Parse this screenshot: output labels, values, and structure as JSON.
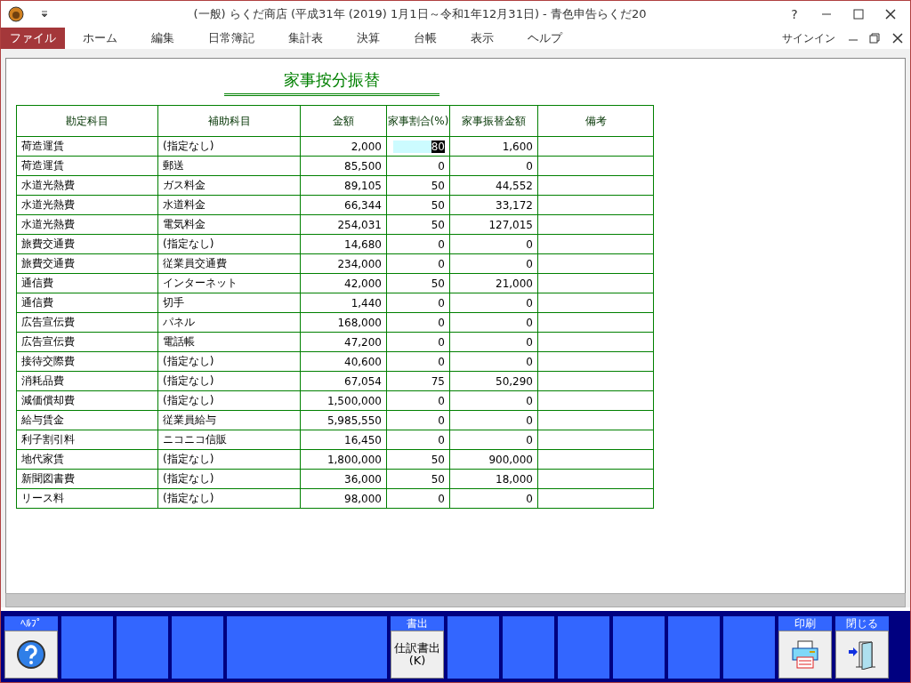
{
  "window": {
    "title": "(一般) らくだ商店 (平成31年 (2019) 1月1日～令和1年12月31日) - 青色申告らくだ20",
    "help": "?",
    "signin": "サインイン"
  },
  "menu": [
    {
      "label": "ファイル",
      "selected": true
    },
    {
      "label": "ホーム",
      "selected": false
    },
    {
      "label": "編集",
      "selected": false
    },
    {
      "label": "日常簿記",
      "selected": false
    },
    {
      "label": "集計表",
      "selected": false
    },
    {
      "label": "決算",
      "selected": false
    },
    {
      "label": "台帳",
      "selected": false
    },
    {
      "label": "表示",
      "selected": false
    },
    {
      "label": "ヘルプ",
      "selected": false
    }
  ],
  "page_title": "家事按分振替",
  "table": {
    "columns": [
      "勘定科目",
      "補助科目",
      "金額",
      "家事割合(%)",
      "家事振替金額",
      "備考"
    ],
    "rows": [
      {
        "account": "荷造運賃",
        "sub": "(指定なし)",
        "amount": "2,000",
        "rate": "80",
        "transfer": "1,600",
        "selected": true
      },
      {
        "account": "荷造運賃",
        "sub": "郵送",
        "amount": "85,500",
        "rate": "0",
        "transfer": "0",
        "selected": false
      },
      {
        "account": "水道光熱費",
        "sub": "ガス料金",
        "amount": "89,105",
        "rate": "50",
        "transfer": "44,552",
        "selected": false
      },
      {
        "account": "水道光熱費",
        "sub": "水道料金",
        "amount": "66,344",
        "rate": "50",
        "transfer": "33,172",
        "selected": false
      },
      {
        "account": "水道光熱費",
        "sub": "電気料金",
        "amount": "254,031",
        "rate": "50",
        "transfer": "127,015",
        "selected": false
      },
      {
        "account": "旅費交通費",
        "sub": "(指定なし)",
        "amount": "14,680",
        "rate": "0",
        "transfer": "0",
        "selected": false
      },
      {
        "account": "旅費交通費",
        "sub": "従業員交通費",
        "amount": "234,000",
        "rate": "0",
        "transfer": "0",
        "selected": false
      },
      {
        "account": "通信費",
        "sub": "インターネット",
        "amount": "42,000",
        "rate": "50",
        "transfer": "21,000",
        "selected": false
      },
      {
        "account": "通信費",
        "sub": "切手",
        "amount": "1,440",
        "rate": "0",
        "transfer": "0",
        "selected": false
      },
      {
        "account": "広告宣伝費",
        "sub": "パネル",
        "amount": "168,000",
        "rate": "0",
        "transfer": "0",
        "selected": false
      },
      {
        "account": "広告宣伝費",
        "sub": "電話帳",
        "amount": "47,200",
        "rate": "0",
        "transfer": "0",
        "selected": false
      },
      {
        "account": "接待交際費",
        "sub": "(指定なし)",
        "amount": "40,600",
        "rate": "0",
        "transfer": "0",
        "selected": false
      },
      {
        "account": "消耗品費",
        "sub": "(指定なし)",
        "amount": "67,054",
        "rate": "75",
        "transfer": "50,290",
        "selected": false
      },
      {
        "account": "減価償却費",
        "sub": "(指定なし)",
        "amount": "1,500,000",
        "rate": "0",
        "transfer": "0",
        "selected": false
      },
      {
        "account": "給与賃金",
        "sub": "従業員給与",
        "amount": "5,985,550",
        "rate": "0",
        "transfer": "0",
        "selected": false
      },
      {
        "account": "利子割引料",
        "sub": "ニコニコ信販",
        "amount": "16,450",
        "rate": "0",
        "transfer": "0",
        "selected": false
      },
      {
        "account": "地代家賃",
        "sub": "(指定なし)",
        "amount": "1,800,000",
        "rate": "50",
        "transfer": "900,000",
        "selected": false
      },
      {
        "account": "新聞図書費",
        "sub": "(指定なし)",
        "amount": "36,000",
        "rate": "50",
        "transfer": "18,000",
        "selected": false
      },
      {
        "account": "リース料",
        "sub": "(指定なし)",
        "amount": "98,000",
        "rate": "0",
        "transfer": "0",
        "selected": false
      }
    ]
  },
  "function_keys": [
    {
      "kind": "help",
      "label": "ﾍﾙﾌﾟ"
    },
    {
      "kind": "blank"
    },
    {
      "kind": "blank"
    },
    {
      "kind": "blank"
    },
    {
      "kind": "wide"
    },
    {
      "kind": "text",
      "label": "書出",
      "text": "仕訳書出",
      "key": "(K)"
    },
    {
      "kind": "blank"
    },
    {
      "kind": "blank"
    },
    {
      "kind": "blank"
    },
    {
      "kind": "blank"
    },
    {
      "kind": "blank"
    },
    {
      "kind": "blank"
    },
    {
      "kind": "print",
      "label": "印刷"
    },
    {
      "kind": "close",
      "label": "閉じる"
    }
  ]
}
